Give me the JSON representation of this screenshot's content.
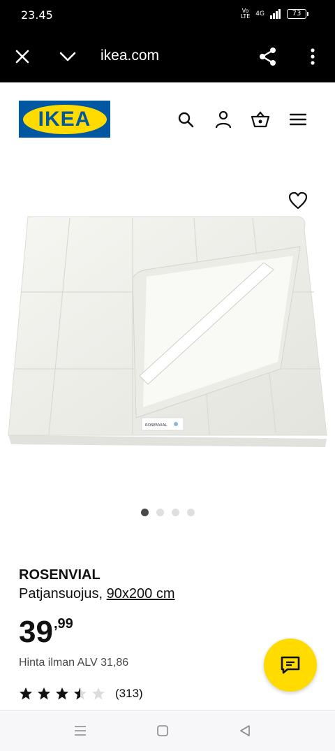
{
  "status_bar": {
    "time": "23.45",
    "network_volte": "Vo LTE",
    "network_type": "4G",
    "battery": "73"
  },
  "browser": {
    "url": "ikea.com",
    "icons": [
      "close-icon",
      "chevron-down-icon",
      "share-icon",
      "more-vert-icon"
    ]
  },
  "header": {
    "logo_text": "IKEA",
    "icons": [
      "search-icon",
      "user-icon",
      "basket-icon",
      "menu-icon"
    ]
  },
  "gallery": {
    "image_count": 4,
    "active_index": 0,
    "tag_text": "ROSENVIAL"
  },
  "product": {
    "name": "ROSENVIAL",
    "description": "Patjansuojus,",
    "size": "90x200 cm",
    "price_integer": "39",
    "price_decimal": ",99",
    "price_ex_vat": "Hinta ilman ALV 31,86",
    "rating": 3.5,
    "rating_max": 5,
    "rating_count": "(313)"
  },
  "colors": {
    "ikea_blue": "#0058a3",
    "ikea_yellow": "#ffdb00",
    "text": "#111111"
  }
}
